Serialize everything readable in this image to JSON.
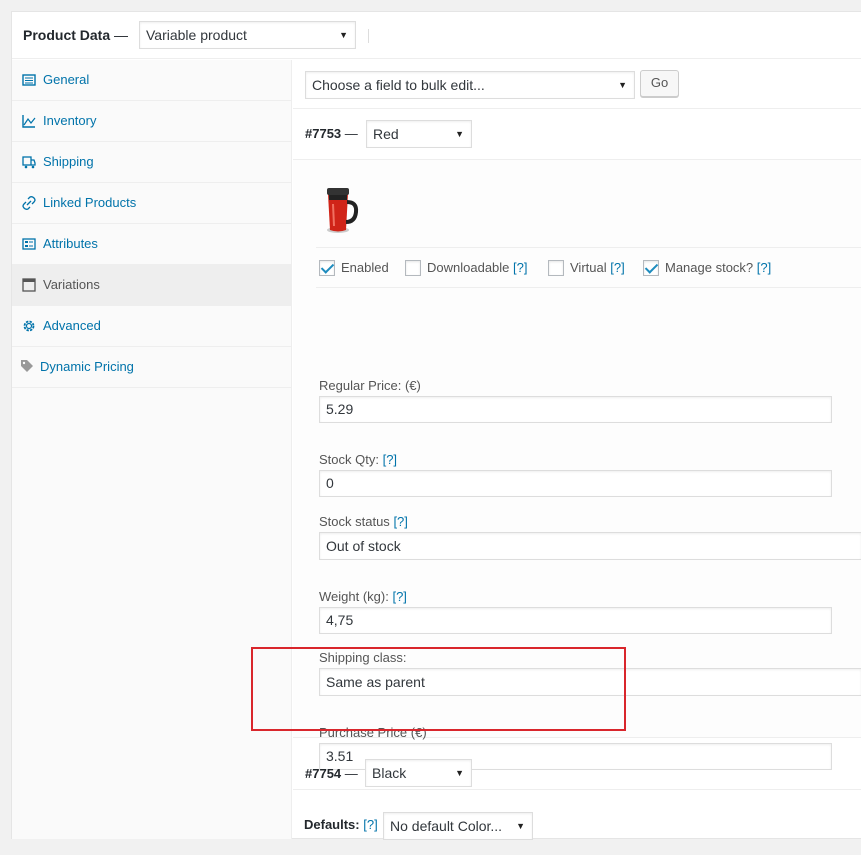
{
  "header": {
    "title": "Product Data",
    "separator": "—",
    "product_type": "Variable product"
  },
  "sidebar": {
    "items": [
      {
        "label": "General",
        "icon": "general-icon"
      },
      {
        "label": "Inventory",
        "icon": "inventory-icon"
      },
      {
        "label": "Shipping",
        "icon": "shipping-icon"
      },
      {
        "label": "Linked Products",
        "icon": "link-icon"
      },
      {
        "label": "Attributes",
        "icon": "attributes-icon"
      },
      {
        "label": "Variations",
        "icon": "variations-icon",
        "active": true
      },
      {
        "label": "Advanced",
        "icon": "gear-icon"
      },
      {
        "label": "Dynamic Pricing",
        "icon": "tag-icon"
      }
    ]
  },
  "bulk": {
    "select": "Choose a field to bulk edit...",
    "go": "Go"
  },
  "variation1": {
    "id": "#7753",
    "dash": "—",
    "value": "Red",
    "options": {
      "enabled": "Enabled",
      "downloadable": "Downloadable",
      "virtual": "Virtual",
      "manage_stock": "Manage stock?",
      "help": "[?]"
    },
    "regular_price_label": "Regular Price: (€)",
    "regular_price": "5.29",
    "stock_qty_label": "Stock Qty:",
    "stock_qty": "0",
    "stock_status_label": "Stock status",
    "stock_status": "Out of stock",
    "weight_label": "Weight (kg):",
    "weight": "4,75",
    "shipping_class_label": "Shipping class:",
    "shipping_class": "Same as parent",
    "purchase_price_label": "Purchase Price (€)",
    "purchase_price": "3.51"
  },
  "variation2": {
    "id": "#7754",
    "dash": "—",
    "value": "Black"
  },
  "defaults": {
    "label": "Defaults:",
    "help": "[?]",
    "value": "No default Color..."
  },
  "colors": {
    "link": "#0073aa",
    "highlight": "#d9262c",
    "checkbox": "#1e8cbe"
  }
}
